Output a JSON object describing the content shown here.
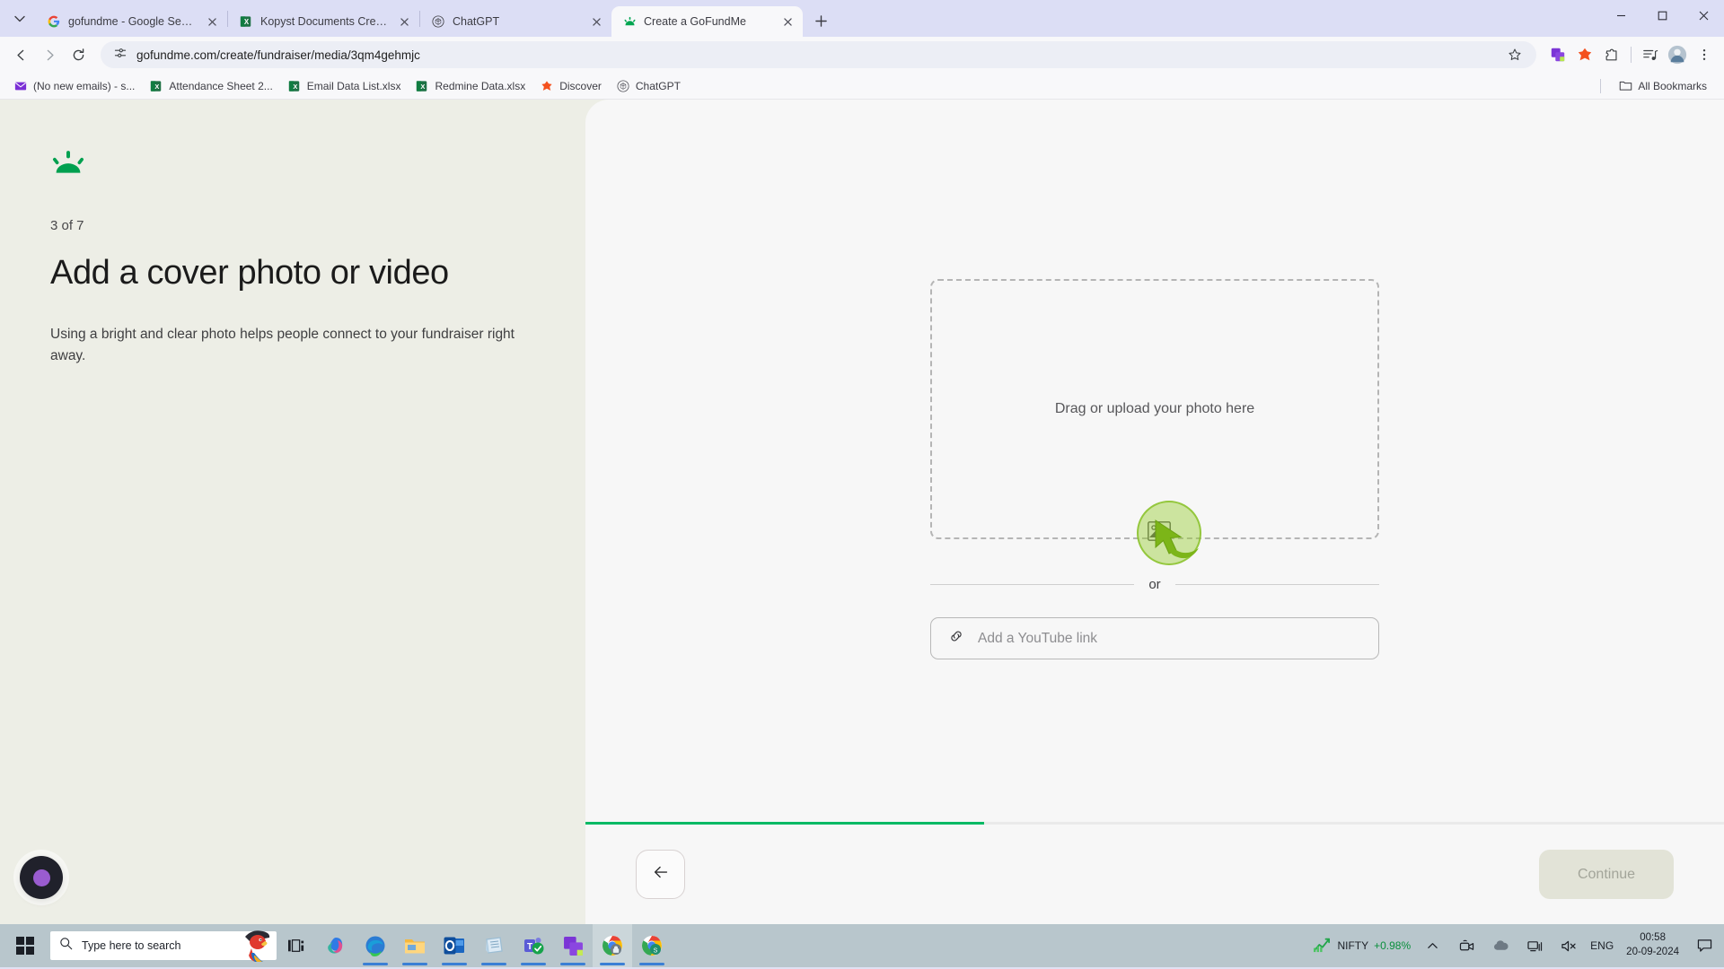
{
  "browser": {
    "tabs": [
      {
        "title": "gofundme - Google Search",
        "icon": "google-icon",
        "active": false
      },
      {
        "title": "Kopyst Documents Creation.xlsx",
        "icon": "excel-icon",
        "active": false
      },
      {
        "title": "ChatGPT",
        "icon": "chatgpt-icon",
        "active": false
      },
      {
        "title": "Create a GoFundMe",
        "icon": "gofundme-icon",
        "active": true
      }
    ],
    "new_tab_label": "+",
    "url": "gofundme.com/create/fundraiser/media/3qm4gehmjc",
    "bookmarks": [
      {
        "label": "(No new emails) - s...",
        "icon": "mail-icon"
      },
      {
        "label": "Attendance Sheet 2...",
        "icon": "excel-icon"
      },
      {
        "label": "Email Data List.xlsx",
        "icon": "excel-icon"
      },
      {
        "label": "Redmine Data.xlsx",
        "icon": "excel-icon"
      },
      {
        "label": "Discover",
        "icon": "discover-icon"
      },
      {
        "label": "ChatGPT",
        "icon": "chatgpt-icon"
      }
    ],
    "all_bookmarks_label": "All Bookmarks"
  },
  "page": {
    "logo_name": "gofundme-logo",
    "step_counter": "3 of 7",
    "headline": "Add a cover photo or video",
    "subtext": "Using a bright and clear photo helps people connect to your fundraiser right away.",
    "dropzone_label": "Drag or upload your photo here",
    "or_label": "or",
    "youtube_placeholder": "Add a YouTube link",
    "youtube_value": "",
    "continue_label": "Continue",
    "continue_disabled": true,
    "progress_percent": 35,
    "accent_color": "#00b964",
    "left_panel_color": "#edeee6",
    "right_panel_color": "#f7f7f7"
  },
  "taskbar": {
    "search_placeholder": "Type here to search",
    "apps": [
      {
        "name": "task-view",
        "running": false
      },
      {
        "name": "copilot",
        "running": false
      },
      {
        "name": "edge",
        "running": true
      },
      {
        "name": "file-explorer",
        "running": true
      },
      {
        "name": "outlook",
        "running": true
      },
      {
        "name": "notepad",
        "running": true
      },
      {
        "name": "teams",
        "running": true
      },
      {
        "name": "kopyst",
        "running": true
      },
      {
        "name": "chrome-1",
        "running": true
      },
      {
        "name": "chrome-2",
        "running": true
      }
    ],
    "tray": {
      "stock_label": "NIFTY",
      "stock_change": "+0.98%",
      "language": "ENG",
      "time": "00:58",
      "date": "20-09-2024"
    }
  }
}
